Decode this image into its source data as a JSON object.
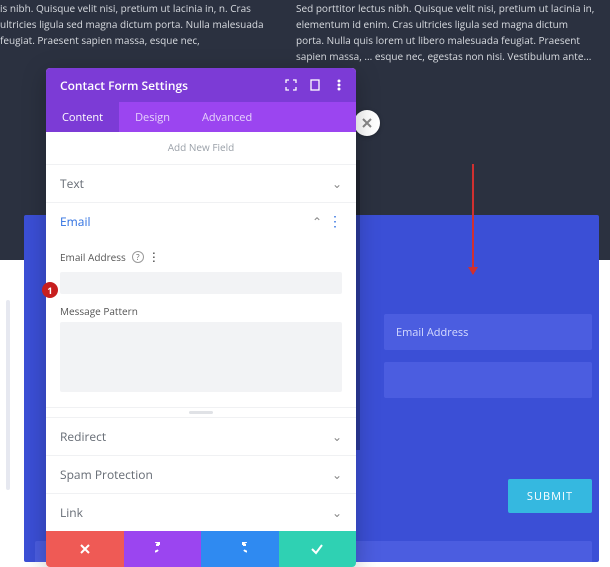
{
  "bg_text": {
    "left": "is nibh. Quisque velit nisi, pretium ut lacinia in, n. Cras ultricies ligula sed magna dictum porta. Nulla malesuada feugiat. Praesent sapien massa, esque nec,",
    "right": "Sed porttitor lectus nibh. Quisque velit nisi, pretium ut lacinia in, elementum id enim. Cras ultricies ligula sed magna dictum porta. Nulla quis lorem ut libero malesuada feugiat. Praesent sapien massa, ... esque nec, egestas non nisi. Vestibulum ante..."
  },
  "modal": {
    "title": "Contact Form Settings",
    "tabs": [
      "Content",
      "Design",
      "Advanced"
    ],
    "active_tab": 0,
    "add_new": "Add New Field",
    "sections": {
      "text": "Text",
      "email": "Email",
      "redirect": "Redirect",
      "spam": "Spam Protection",
      "link": "Link"
    },
    "email": {
      "addr_label": "Email Address",
      "pattern_label": "Message Pattern"
    }
  },
  "form": {
    "email_placeholder": "Email Address",
    "submit": "SUBMIT"
  },
  "badge1": "1"
}
